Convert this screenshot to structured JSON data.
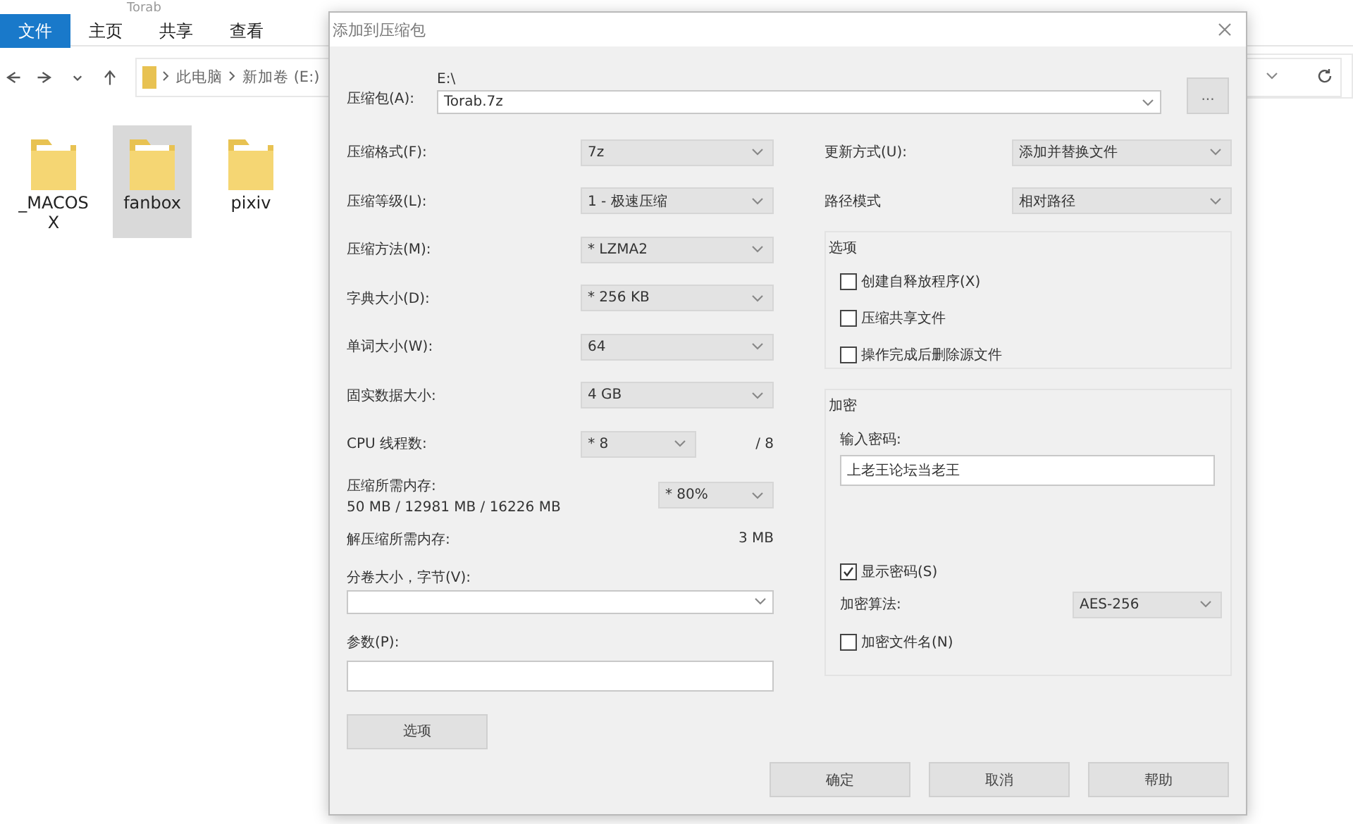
{
  "explorer": {
    "title": "Torab",
    "ribbon_tabs": [
      {
        "label": "文件",
        "selected": true
      },
      {
        "label": "主页",
        "selected": false
      },
      {
        "label": "共享",
        "selected": false
      },
      {
        "label": "查看",
        "selected": false
      }
    ],
    "breadcrumb": [
      "此电脑",
      "新加卷 (E:)"
    ],
    "folders": [
      {
        "name": "_MACOSX",
        "selected": false
      },
      {
        "name": "fanbox",
        "selected": true
      },
      {
        "name": "pixiv",
        "selected": false
      }
    ]
  },
  "dialog": {
    "title": "添加到压缩包",
    "archive": {
      "label": "压缩包(A):",
      "path": "E:\\",
      "value": "Torab.7z"
    },
    "browse_button": "...",
    "left_options": [
      {
        "label": "压缩格式(F):",
        "value": "7z"
      },
      {
        "label": "压缩等级(L):",
        "value": "1 - 极速压缩"
      },
      {
        "label": "压缩方法(M):",
        "value": "* LZMA2"
      },
      {
        "label": "字典大小(D):",
        "value": "* 256 KB"
      },
      {
        "label": "单词大小(W):",
        "value": "64"
      },
      {
        "label": "固实数据大小:",
        "value": "4 GB"
      }
    ],
    "cpu": {
      "label": "CPU 线程数:",
      "value": "* 8",
      "max": "/ 8"
    },
    "memory": {
      "label": "压缩所需内存:",
      "value": "50 MB / 12981 MB / 16226 MB",
      "limit": "* 80%"
    },
    "decompress": {
      "label": "解压缩所需内存:",
      "value": "3 MB"
    },
    "split": {
      "label": "分卷大小，字节(V):"
    },
    "params": {
      "label": "参数(P):"
    },
    "options_button": "选项",
    "right_options": [
      {
        "label": "更新方式(U):",
        "value": "添加并替换文件"
      },
      {
        "label": "路径模式",
        "value": "相对路径"
      }
    ],
    "options_group": {
      "title": "选项",
      "checkboxes": [
        {
          "label": "创建自释放程序(X)",
          "checked": false
        },
        {
          "label": "压缩共享文件",
          "checked": false
        },
        {
          "label": "操作完成后删除源文件",
          "checked": false
        }
      ]
    },
    "encryption": {
      "title": "加密",
      "password_label": "输入密码:",
      "password": "上老王论坛当老王",
      "show_password": {
        "label": "显示密码(S)",
        "checked": true
      },
      "method_label": "加密算法:",
      "method": "AES-256",
      "encrypt_names": {
        "label": "加密文件名(N)",
        "checked": false
      }
    },
    "buttons": [
      "确定",
      "取消",
      "帮助"
    ]
  }
}
